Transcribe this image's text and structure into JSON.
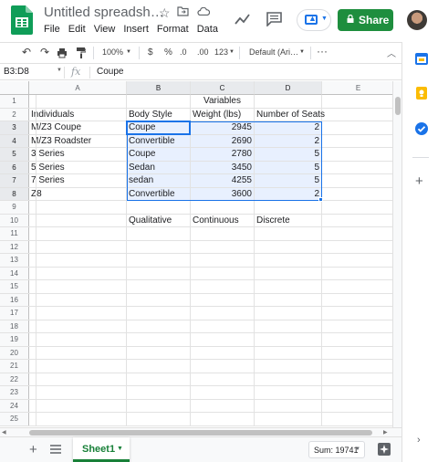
{
  "app": {
    "doc_title": "Untitled spreadsh…",
    "menu": [
      "File",
      "Edit",
      "View",
      "Insert",
      "Format",
      "Data"
    ],
    "share_label": "Share",
    "accent_color": "#1e8e3e",
    "icons": {
      "star": "star-icon",
      "folder": "move-to-folder-icon",
      "cloud": "cloud-saved-icon",
      "trend": "activity-dashboard-icon",
      "comment": "comments-icon",
      "present": "present-icon"
    }
  },
  "toolbar": {
    "zoom": "100%",
    "currency": "$",
    "percent": "%",
    "dec_decrease": ".0",
    "dec_increase": ".00",
    "more_formats": "123",
    "font": "Default (Ari…"
  },
  "formula_bar": {
    "name_box": "B3:D8",
    "fx": "fx",
    "value": "Coupe"
  },
  "sheet": {
    "columns": [
      "A",
      "B",
      "C",
      "D",
      "E"
    ],
    "row_numbers": [
      "1",
      "2",
      "3",
      "4",
      "5",
      "6",
      "7",
      "8",
      "9",
      "10",
      "11",
      "12",
      "13",
      "14",
      "15",
      "16",
      "17",
      "18",
      "19",
      "20",
      "21",
      "22",
      "23",
      "24",
      "25"
    ],
    "row1": {
      "variables": "Variables"
    },
    "headers": {
      "A": "Individuals",
      "B": "Body Style",
      "C": "Weight (lbs)",
      "D": "Number of Seats"
    },
    "rows": [
      {
        "A": "M/Z3 Coupe",
        "B": "Coupe",
        "C": "2945",
        "D": "2"
      },
      {
        "A": "M/Z3 Roadster",
        "B": "Convertible",
        "C": "2690",
        "D": "2"
      },
      {
        "A": "3 Series",
        "B": "Coupe",
        "C": "2780",
        "D": "5"
      },
      {
        "A": "5 Series",
        "B": "Sedan",
        "C": "3450",
        "D": "5"
      },
      {
        "A": "7 Series",
        "B": "sedan",
        "C": "4255",
        "D": "5"
      },
      {
        "A": "Z8",
        "B": "Convertible",
        "C": "3600",
        "D": "2"
      }
    ],
    "row10": {
      "B": "Qualitative",
      "C": "Continuous",
      "D": "Discrete"
    }
  },
  "bottom": {
    "sheet_tab": "Sheet1",
    "sum": "Sum: 19741"
  }
}
